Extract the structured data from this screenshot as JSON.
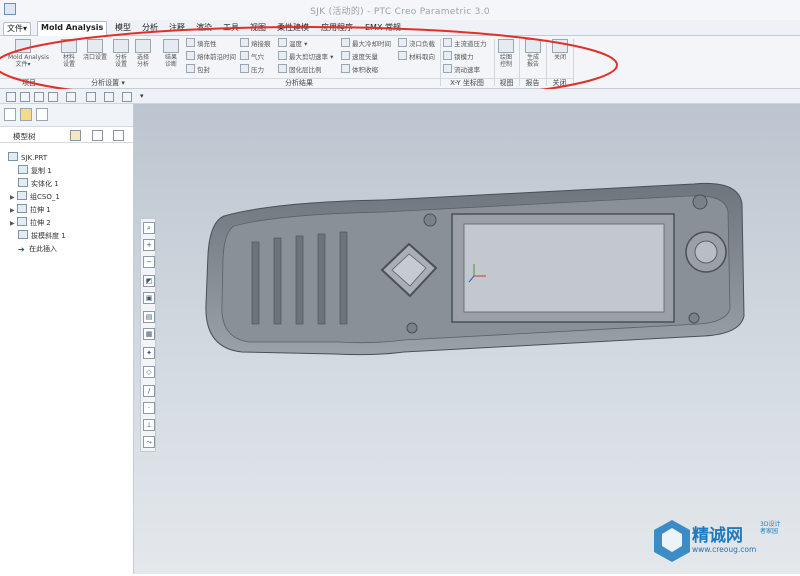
{
  "window": {
    "title": "SJK (活动的) - PTC Creo Parametric 3.0"
  },
  "menu_tabs": [
    {
      "label": "文件▾"
    },
    {
      "label": "Mold Analysis"
    },
    {
      "label": "模型"
    },
    {
      "label": "分析"
    },
    {
      "label": "注释"
    },
    {
      "label": "渲染"
    },
    {
      "label": "工具"
    },
    {
      "label": "视图"
    },
    {
      "label": "柔性建模"
    },
    {
      "label": "应用程序"
    },
    {
      "label": "EMX 常规"
    }
  ],
  "ribbon": {
    "groups": [
      {
        "label": "项目"
      },
      {
        "label": "分析设置 ▾"
      },
      {
        "label": "分析结果"
      },
      {
        "label": "X-Y 坐标图"
      },
      {
        "label": "视图"
      },
      {
        "label": "报告"
      },
      {
        "label": "关闭"
      }
    ],
    "big_buttons": [
      {
        "label": "Mold Analysis\n文件▾"
      },
      {
        "label": "材料\n设置"
      },
      {
        "label": "浇口设置"
      },
      {
        "label": "分析\n设置"
      },
      {
        "label": "选择\n分析"
      },
      {
        "label": "结果\n诊断"
      },
      {
        "label": "绘图\n控制"
      },
      {
        "label": "生成\n报告"
      },
      {
        "label": "关闭"
      }
    ],
    "small_buttons": [
      {
        "label": "填充性"
      },
      {
        "label": "熔体前沿时间"
      },
      {
        "label": "包封"
      },
      {
        "label": "熔接痕"
      },
      {
        "label": "气穴"
      },
      {
        "label": "压力"
      },
      {
        "label": "温度 ▾"
      },
      {
        "label": "最大剪切速率 ▾"
      },
      {
        "label": "固化层比例"
      },
      {
        "label": "最大冷却时间"
      },
      {
        "label": "速度矢量"
      },
      {
        "label": "体积收缩"
      },
      {
        "label": "浇口负载"
      },
      {
        "label": "材料取向"
      },
      {
        "label": "主流道压力"
      },
      {
        "label": "锁模力"
      },
      {
        "label": "流动速率"
      }
    ]
  },
  "sidebar": {
    "header": "模型树",
    "items": [
      {
        "label": "SJK.PRT"
      },
      {
        "label": "复制 1"
      },
      {
        "label": "实体化 1"
      },
      {
        "label": "组CSO_1"
      },
      {
        "label": "拉伸 1"
      },
      {
        "label": "拉伸 2"
      },
      {
        "label": "拔模斜度 1"
      },
      {
        "label": "在此插入"
      }
    ]
  },
  "watermark": {
    "brand": "精诚网",
    "sub": "3D设计\n者家园",
    "url": "www.creoug.com"
  },
  "colors": {
    "accent": "#1f7bbf",
    "annotation": "#e0302a",
    "model": "#8d939b"
  }
}
